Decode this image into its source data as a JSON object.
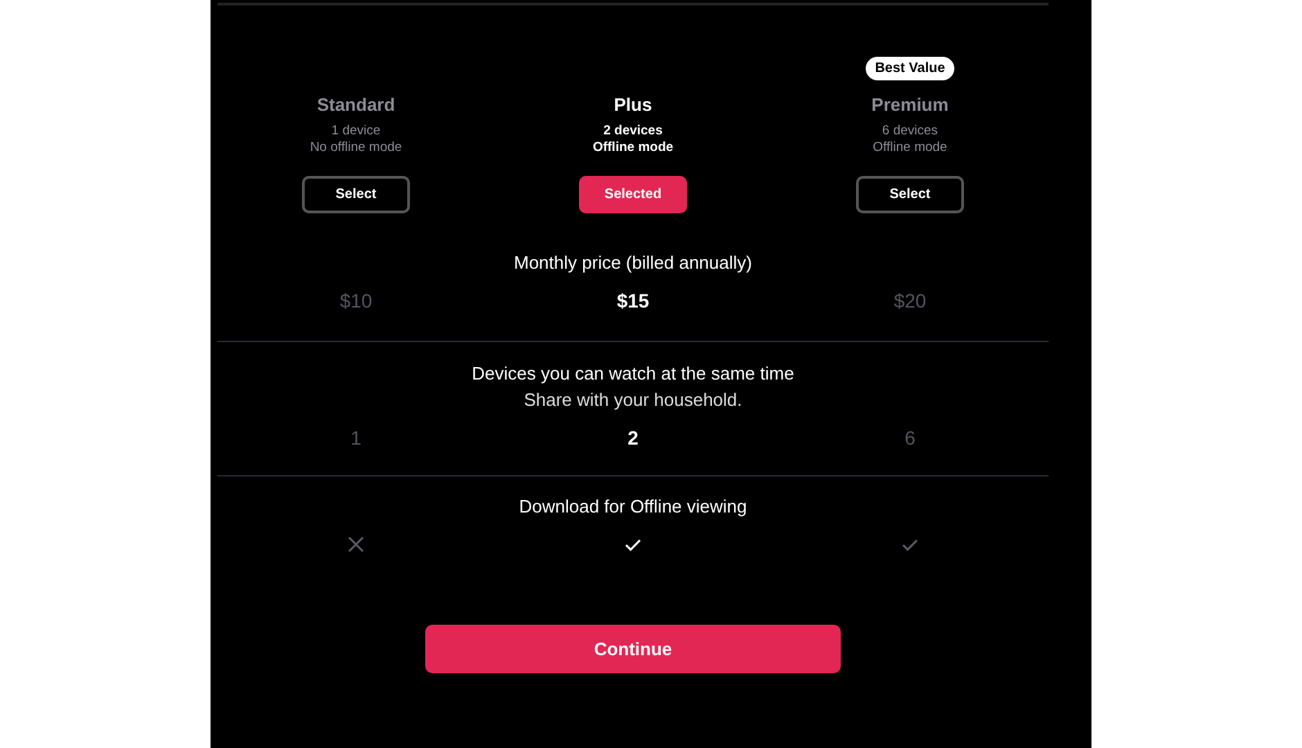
{
  "plans": [
    {
      "name": "Standard",
      "devices": "1 device",
      "offline": "No offline mode",
      "button": "Select",
      "selected": false
    },
    {
      "name": "Plus",
      "devices": "2 devices",
      "offline": "Offline mode",
      "button": "Selected",
      "selected": true
    },
    {
      "name": "Premium",
      "devices": "6 devices",
      "offline": "Offline mode",
      "button": "Select",
      "selected": false,
      "badge": "Best Value"
    }
  ],
  "features": [
    {
      "title": "Monthly price (billed annually)",
      "values": [
        {
          "kind": "text",
          "text": "$10"
        },
        {
          "kind": "text",
          "text": "$15"
        },
        {
          "kind": "text",
          "text": "$20"
        }
      ]
    },
    {
      "title": "Devices you can watch at the same time",
      "subtitle": "Share with your household.",
      "values": [
        {
          "kind": "text",
          "text": "1"
        },
        {
          "kind": "text",
          "text": "2"
        },
        {
          "kind": "text",
          "text": "6"
        }
      ]
    },
    {
      "title": "Download for Offline viewing",
      "values": [
        {
          "kind": "cross"
        },
        {
          "kind": "check"
        },
        {
          "kind": "check"
        }
      ]
    }
  ],
  "continue_button": "Continue"
}
